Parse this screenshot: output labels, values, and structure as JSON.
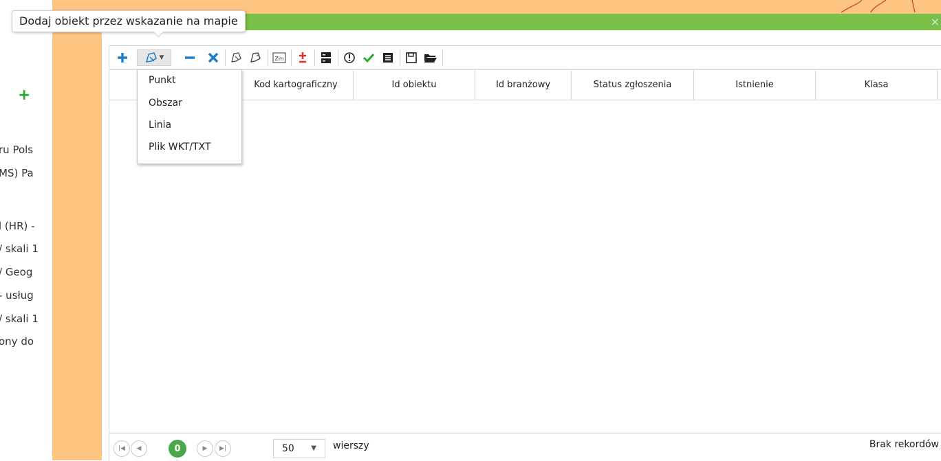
{
  "tooltip": {
    "text": "Dodaj obiekt przez wskazanie na mapie"
  },
  "sidebar": {
    "add_icon": "plus-icon",
    "layers": [
      {
        "label": "ru Pols"
      },
      {
        "label": "MS) Pa"
      },
      {
        "label": "l (HR) -"
      },
      {
        "label": "/ skali 1"
      },
      {
        "label": "/ Geog"
      },
      {
        "label": "- usług"
      },
      {
        "label": "/ skali 1"
      },
      {
        "label": "ony do"
      }
    ]
  },
  "titlebar": {
    "close": "×"
  },
  "toolbar": {
    "icons": [
      "plus-icon",
      "pick-on-map-icon",
      "minus-icon",
      "delete-icon",
      "select-icon",
      "select-area-icon",
      "zoom-icon",
      "plus-minus-icon",
      "database-icon",
      "alert-icon",
      "check-icon",
      "list-icon",
      "save-icon",
      "folder-open-icon"
    ]
  },
  "dropdown": {
    "items": [
      {
        "label": "Punkt"
      },
      {
        "label": "Obszar"
      },
      {
        "label": "Linia"
      },
      {
        "label": "Plik WKT/TXT"
      }
    ]
  },
  "grid": {
    "columns": [
      {
        "label": "Kod kartograficzny"
      },
      {
        "label": "Id obiektu"
      },
      {
        "label": "Id branżowy"
      },
      {
        "label": "Status zgłoszenia"
      },
      {
        "label": "Istnienie"
      },
      {
        "label": "Klasa"
      }
    ],
    "rows": []
  },
  "pager": {
    "current_page": "0",
    "page_size": "50",
    "rows_label": "wierszy",
    "status": "Brak rekordów"
  },
  "colors": {
    "accent_green": "#7abf47",
    "orange": "#fdc57f",
    "icon_blue": "#1f7cc8",
    "icon_red": "#d33",
    "icon_green": "#2bab2b"
  }
}
